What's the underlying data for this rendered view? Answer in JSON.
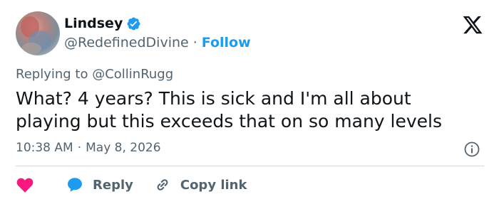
{
  "author": {
    "name": "Lindsey",
    "handle": "@RedefinedDivine",
    "separator": "·",
    "follow_label": "Follow"
  },
  "tweet": {
    "replying_to": "Replying to @CollinRugg",
    "text": "What? 4 years? This is sick and I'm all about playing but this exceeds that on so many levels",
    "time": "10:38 AM",
    "meta_separator": "·",
    "date": "May 8, 2026"
  },
  "actions": {
    "reply_label": "Reply",
    "copy_link_label": "Copy link"
  },
  "colors": {
    "accent": "#1d9bf0",
    "heart": "#f91880",
    "text": "#0f1419",
    "muted": "#536471"
  },
  "icons": [
    "verified-badge-icon",
    "x-logo-icon",
    "info-icon",
    "heart-icon",
    "reply-bubble-icon",
    "link-icon"
  ]
}
